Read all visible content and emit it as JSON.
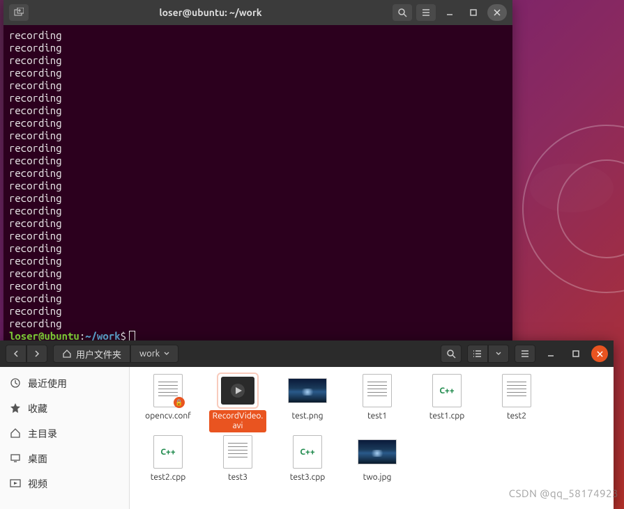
{
  "terminal": {
    "title": "loser@ubuntu: ~/work",
    "output_line": "recording",
    "output_count": 24,
    "prompt": {
      "user": "loser@ubuntu",
      "colon": ":",
      "path": "~/work",
      "dollar": "$"
    }
  },
  "files": {
    "path_crumbs": {
      "home_label": "用户文件夹",
      "current": "work"
    },
    "sidebar": [
      {
        "id": "recent",
        "label": "最近使用"
      },
      {
        "id": "starred",
        "label": "收藏"
      },
      {
        "id": "home",
        "label": "主目录"
      },
      {
        "id": "desktop",
        "label": "桌面"
      },
      {
        "id": "videos",
        "label": "视频"
      }
    ],
    "items": [
      {
        "name": "opencv.conf",
        "kind": "doc",
        "locked": true
      },
      {
        "name": "RecordVideo.avi",
        "kind": "video",
        "selected": true
      },
      {
        "name": "test.png",
        "kind": "image"
      },
      {
        "name": "test1",
        "kind": "doc"
      },
      {
        "name": "test1.cpp",
        "kind": "cpp"
      },
      {
        "name": "test2",
        "kind": "doc"
      },
      {
        "name": "test2.cpp",
        "kind": "cpp"
      },
      {
        "name": "test3",
        "kind": "doc"
      },
      {
        "name": "test3.cpp",
        "kind": "cpp"
      },
      {
        "name": "two.jpg",
        "kind": "image"
      }
    ],
    "cpp_badge": "C++"
  },
  "watermark": "CSDN @qq_58174923"
}
